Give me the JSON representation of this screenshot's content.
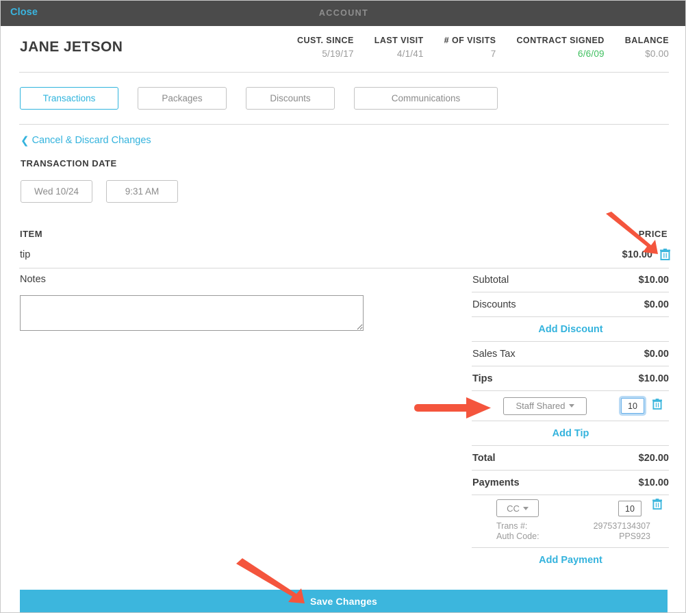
{
  "topbar": {
    "close_label": "Close",
    "title": "ACCOUNT"
  },
  "customer": {
    "name": "JANE JETSON",
    "stats": [
      {
        "label": "CUST. SINCE",
        "value": "5/19/17"
      },
      {
        "label": "LAST VISIT",
        "value": "4/1/41"
      },
      {
        "label": "# OF VISITS",
        "value": "7"
      },
      {
        "label": "CONTRACT SIGNED",
        "value": "6/6/09"
      },
      {
        "label": "BALANCE",
        "value": "$0.00"
      }
    ]
  },
  "tabs": [
    {
      "label": "Transactions"
    },
    {
      "label": "Packages"
    },
    {
      "label": "Discounts"
    },
    {
      "label": "Communications"
    }
  ],
  "actions": {
    "cancel_label": "Cancel & Discard Changes",
    "chevron": "‹"
  },
  "transaction": {
    "date_section_label": "TRANSACTION DATE",
    "date_button": "Wed 10/24",
    "time_button": "9:31 AM"
  },
  "items": {
    "col_item": "ITEM",
    "col_price": "PRICE",
    "rows": [
      {
        "name": "tip",
        "price": "$10.00"
      }
    ]
  },
  "notes": {
    "label": "Notes",
    "value": "",
    "placeholder": ""
  },
  "summary": {
    "subtotal": {
      "label": "Subtotal",
      "value": "$10.00"
    },
    "discounts": {
      "label": "Discounts",
      "value": "$0.00"
    },
    "add_discount": "Add Discount",
    "sales_tax": {
      "label": "Sales Tax",
      "value": "$0.00"
    },
    "tips": {
      "label": "Tips",
      "value": "$10.00"
    },
    "tip_rows": [
      {
        "type": "Staff Shared",
        "amount": "10"
      }
    ],
    "add_tip": "Add Tip",
    "total": {
      "label": "Total",
      "value": "$20.00"
    },
    "payments": {
      "label": "Payments",
      "value": "$10.00"
    },
    "payment_rows": [
      {
        "method": "CC",
        "amount": "10",
        "trans_label": "Trans #:",
        "trans_value": "297537134307",
        "auth_label": "Auth Code:",
        "auth_value": "PPS923"
      }
    ],
    "add_payment": "Add Payment"
  },
  "footer": {
    "save_label": "Save Changes"
  },
  "colors": {
    "accent_blue": "#34b3dd",
    "save_bar": "#3cb6dd",
    "green": "#3fbf5f",
    "topbar": "#4b4b4b",
    "arrow_red": "#f4553d",
    "text": "#3c3c3c",
    "muted": "#9b9b9b",
    "border": "#d8d8d8"
  }
}
